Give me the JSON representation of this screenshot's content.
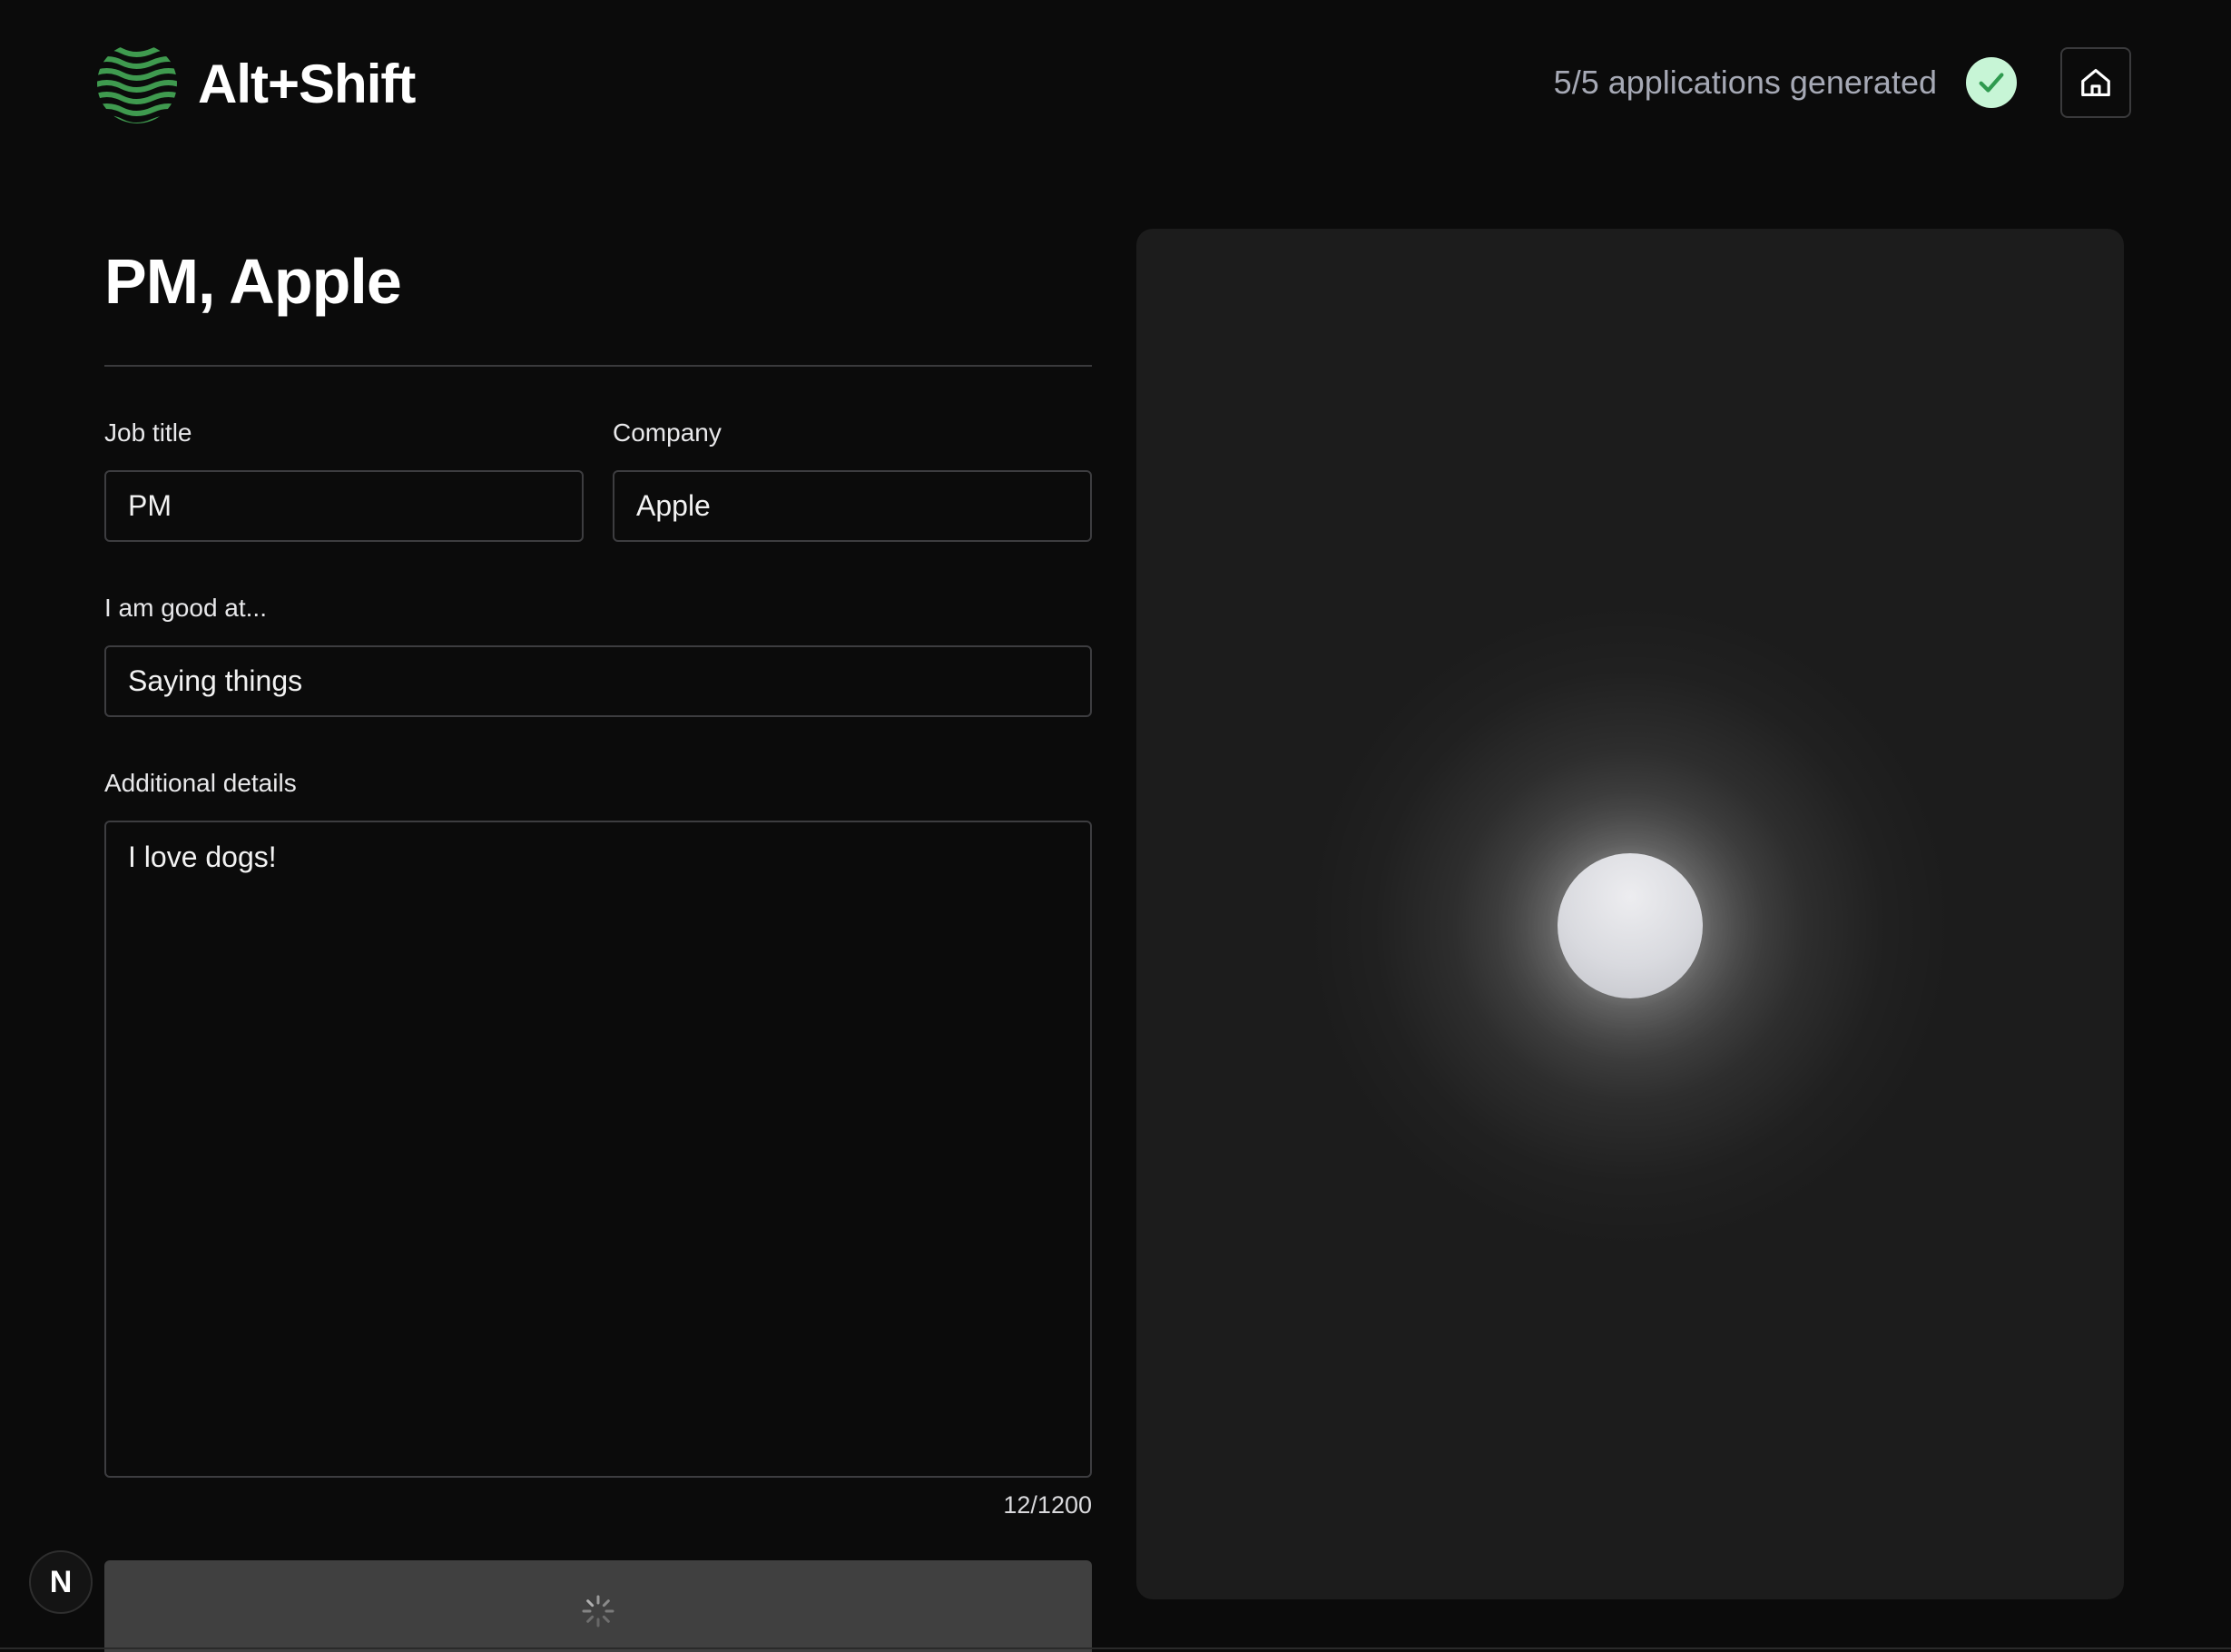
{
  "brand": {
    "name": "Alt+Shift",
    "logo_icon": "wave-logo-icon",
    "accent_color": "#3f9a4f"
  },
  "header": {
    "progress_text": "5/5 applications generated",
    "check_icon": "check-icon",
    "check_color": "#c7f5d6",
    "home_icon": "home-icon"
  },
  "form": {
    "title": "PM, Apple",
    "job_title": {
      "label": "Job title",
      "value": "PM"
    },
    "company": {
      "label": "Company",
      "value": "Apple"
    },
    "good_at": {
      "label": "I am good at...",
      "value": "Saying things"
    },
    "details": {
      "label": "Additional details",
      "value": "I love dogs!",
      "counter": "12/1200"
    },
    "submit": {
      "state": "loading",
      "icon": "spinner-icon"
    }
  },
  "preview": {
    "state": "loading",
    "icon": "glowing-orb"
  },
  "dev_badge": {
    "label": "N"
  }
}
